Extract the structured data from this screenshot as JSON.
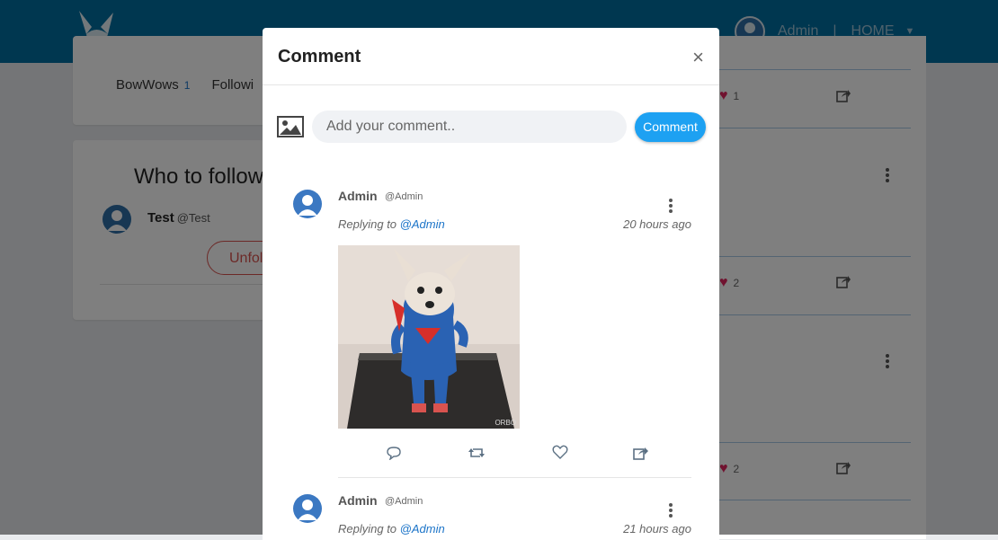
{
  "header": {
    "user_name": "Admin",
    "separator": "|",
    "home_label": "HOME",
    "brand_color": "#006ea1"
  },
  "left": {
    "tabs": [
      {
        "label": "BowWows",
        "count": "1"
      },
      {
        "label": "Followi",
        "count": ""
      }
    ],
    "who_to_follow": {
      "title": "Who to follow",
      "user": {
        "name": "Test",
        "handle": "@Test"
      },
      "button": "Unfollow"
    }
  },
  "feed": {
    "likes": [
      "1",
      "2",
      "2"
    ]
  },
  "modal": {
    "title": "Comment",
    "close": "×",
    "input_placeholder": "Add your comment..",
    "submit": "Comment",
    "comments": [
      {
        "name": "Admin",
        "handle": "@Admin",
        "replying_prefix": "Replying to",
        "replying_to": "@Admin",
        "time": "20 hours ago",
        "gif_watermark": "ORBO"
      },
      {
        "name": "Admin",
        "handle": "@Admin",
        "replying_prefix": "Replying to",
        "replying_to": "@Admin",
        "time": "21 hours ago"
      }
    ]
  },
  "icons": {
    "like": "heart-icon",
    "share": "share-icon",
    "reply": "comment-icon",
    "retweet": "retweet-icon",
    "more": "more-vertical-icon",
    "image": "image-icon",
    "close": "close-icon"
  }
}
